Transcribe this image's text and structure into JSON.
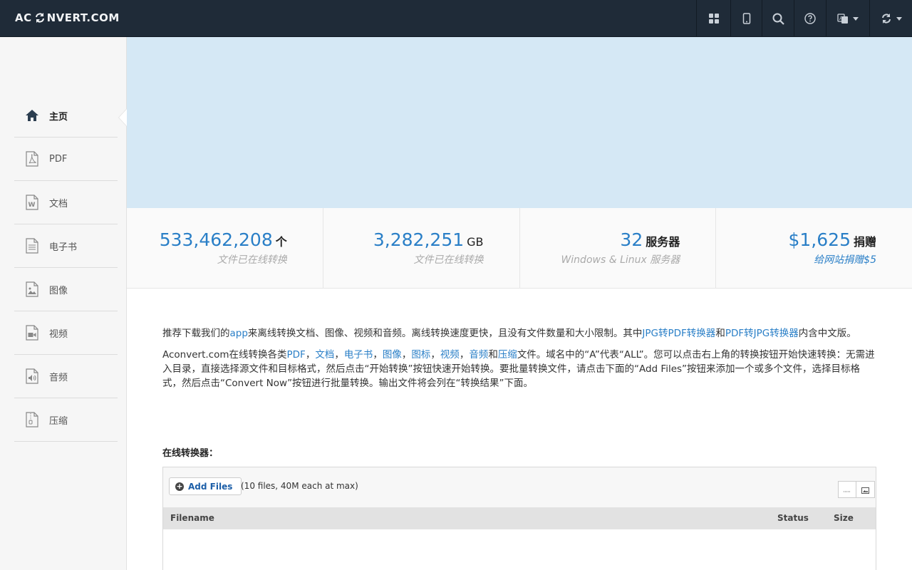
{
  "header": {
    "logo_left": "AC",
    "logo_right": "NVERT.COM",
    "nav_icons": [
      "grid-icon",
      "mobile-icon",
      "search-icon",
      "help-icon",
      "language-icon",
      "convert-icon"
    ]
  },
  "sidebar": {
    "items": [
      {
        "label": "主页",
        "icon": "home-icon",
        "active": true
      },
      {
        "label": "PDF",
        "icon": "pdf-icon"
      },
      {
        "label": "文档",
        "icon": "document-icon"
      },
      {
        "label": "电子书",
        "icon": "ebook-icon"
      },
      {
        "label": "图像",
        "icon": "image-icon"
      },
      {
        "label": "视频",
        "icon": "video-icon"
      },
      {
        "label": "音频",
        "icon": "audio-icon"
      },
      {
        "label": "压缩",
        "icon": "archive-icon"
      }
    ]
  },
  "stats": [
    {
      "value": "533,462,208",
      "unit": "个",
      "desc": "文件已在线转换"
    },
    {
      "value": "3,282,251",
      "unit": "GB",
      "desc": "文件已在线转换"
    },
    {
      "value": "32",
      "unit": "服务器",
      "desc": "Windows & Linux 服务器"
    },
    {
      "value": "$1,625",
      "unit": "捐赠",
      "desc": "给网站捐赠$5"
    }
  ],
  "intro": {
    "p1_a": "推荐下载我们的",
    "p1_link_app": "app",
    "p1_b": "来离线转换文档、图像、视频和音频。离线转换速度更快，且没有文件数量和大小限制。其中",
    "p1_link_jpg2pdf": "JPG转PDF转换器",
    "p1_c": "和",
    "p1_link_pdf2jpg": "PDF转JPG转换器",
    "p1_d": "内含中文版。",
    "p2_a": "Aconvert.com在线转换各类",
    "p2_links": [
      "PDF",
      "文档",
      "电子书",
      "图像",
      "图标",
      "视频",
      "音频"
    ],
    "p2_sep": "，",
    "p2_and": "和",
    "p2_link_last": "压缩",
    "p2_b": "文件。域名中的“A”代表“ALL”。您可以点击右上角的转换按钮开始快速转换：无需进入目录，直接选择源文件和目标格式，然后点击“开始转换”按钮快速开始转换。要批量转换文件，请点击下面的“Add Files”按钮来添加一个或多个文件，选择目标格式，然后点击“Convert Now”按钮进行批量转换。输出文件将会列在“转换结果”下面。"
  },
  "converter": {
    "section_title": "在线转换器：",
    "add_files_label": "Add Files",
    "limit_text": "(10 files, 40M each at max)",
    "columns": {
      "filename": "Filename",
      "status": "Status",
      "size": "Size"
    }
  }
}
